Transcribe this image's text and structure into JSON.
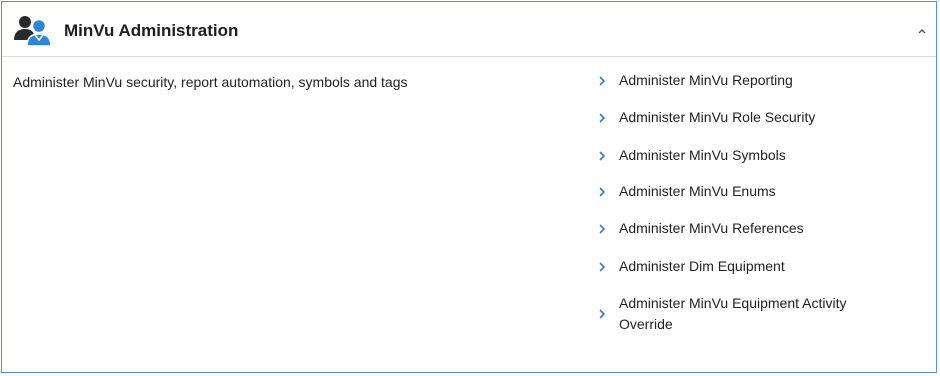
{
  "header": {
    "title": "MinVu Administration",
    "icon": "admin-users-icon",
    "collapse_icon": "chevron-up-icon"
  },
  "description": "Administer MinVu security, report automation, symbols and tags",
  "links": [
    {
      "label": "Administer MinVu Reporting"
    },
    {
      "label": "Administer MinVu Role Security"
    },
    {
      "label": "Administer MinVu Symbols"
    },
    {
      "label": "Administer MinVu Enums"
    },
    {
      "label": "Administer MinVu References"
    },
    {
      "label": "Administer Dim Equipment"
    },
    {
      "label": "Administer MinVu Equipment Activity Override"
    }
  ],
  "colors": {
    "border": "#5b8fd6",
    "chevron": "#3a78c9",
    "icon_dark": "#2b2b2b",
    "icon_blue": "#2f86d6"
  }
}
